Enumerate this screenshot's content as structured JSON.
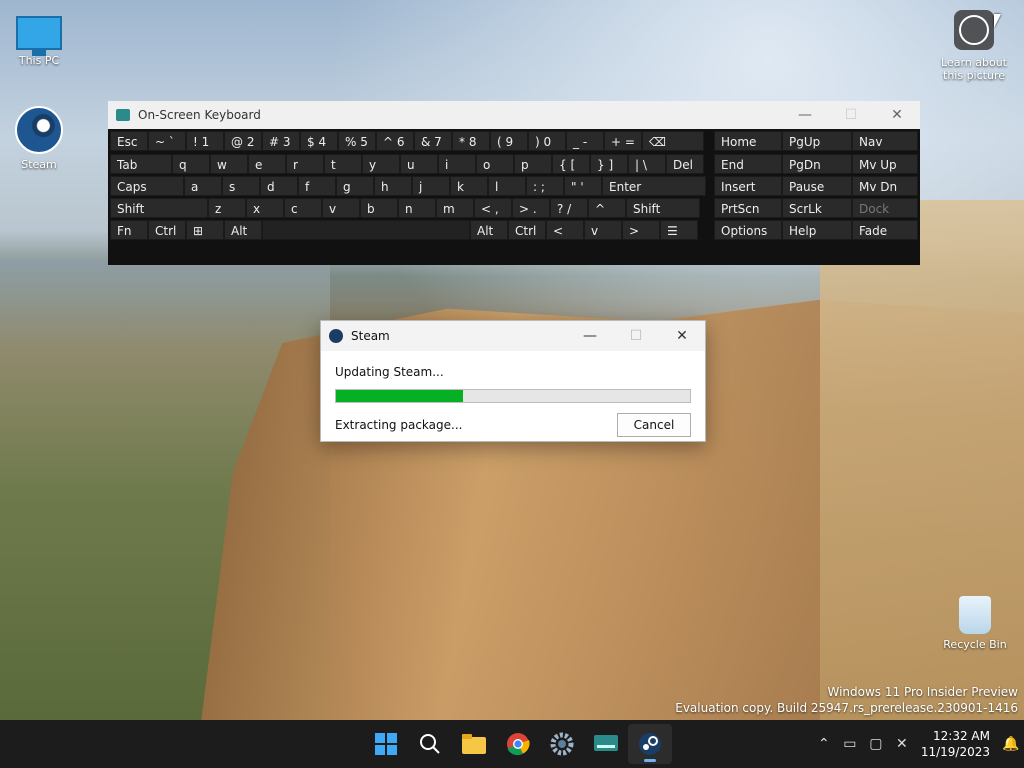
{
  "desktop": {
    "icons": [
      {
        "label": "This PC",
        "icon": "monitor-icon"
      },
      {
        "label": "Steam",
        "icon": "steam-icon"
      },
      {
        "label": "Recycle Bin",
        "icon": "recycle-bin-icon"
      }
    ],
    "learn_about": {
      "line1": "Learn about",
      "line2": "this picture"
    },
    "watermark": {
      "line1": "Windows 11 Pro Insider Preview",
      "line2": "Evaluation copy. Build 25947.rs_prerelease.230901-1416"
    }
  },
  "osk": {
    "title": "On-Screen Keyboard",
    "controls": {
      "minimize": "—",
      "maximize": "☐",
      "close": "✕"
    },
    "rows": [
      [
        "Esc",
        "~ `",
        "! 1",
        "@ 2",
        "# 3",
        "$ 4",
        "% 5",
        "^ 6",
        "& 7",
        "* 8",
        "( 9",
        ") 0",
        "_ -",
        "+ =",
        "⌫"
      ],
      [
        "Tab",
        "q",
        "w",
        "e",
        "r",
        "t",
        "y",
        "u",
        "i",
        "o",
        "p",
        "{ [",
        "} ]",
        "| \\",
        "Del"
      ],
      [
        "Caps",
        "a",
        "s",
        "d",
        "f",
        "g",
        "h",
        "j",
        "k",
        "l",
        ": ;",
        "\" '",
        "Enter"
      ],
      [
        "Shift",
        "z",
        "x",
        "c",
        "v",
        "b",
        "n",
        "m",
        "< ,",
        "> .",
        "? /",
        "^",
        "Shift"
      ],
      [
        "Fn",
        "Ctrl",
        "⊞",
        "Alt",
        "",
        "Alt",
        "Ctrl",
        "<",
        "v",
        ">",
        "☰"
      ]
    ],
    "nav_rows": [
      [
        "Home",
        "PgUp",
        "Nav"
      ],
      [
        "End",
        "PgDn",
        "Mv Up"
      ],
      [
        "Insert",
        "Pause",
        "Mv Dn"
      ],
      [
        "PrtScn",
        "ScrLk",
        "Dock"
      ],
      [
        "Options",
        "Help",
        "Fade"
      ]
    ]
  },
  "steam_dialog": {
    "title": "Steam",
    "status": "Updating Steam...",
    "progress_fraction": 0.36,
    "detail": "Extracting package...",
    "cancel_label": "Cancel"
  },
  "taskbar": {
    "apps": [
      "start-icon",
      "search-icon",
      "file-explorer-icon",
      "chrome-icon",
      "settings-icon",
      "on-screen-keyboard-icon",
      "steam-icon"
    ],
    "time": "12:32 AM",
    "date": "11/19/2023"
  },
  "colors": {
    "progress": "#06b025",
    "taskbar": "#1c1c1c",
    "accent": "#3fa9f5"
  }
}
